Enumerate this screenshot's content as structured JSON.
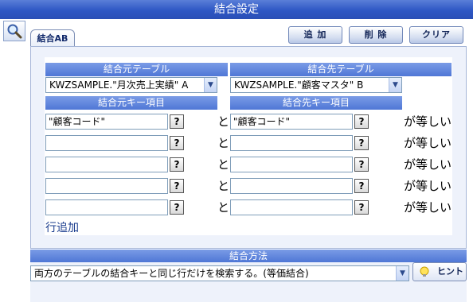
{
  "window": {
    "title": "結合設定"
  },
  "tab": {
    "label": "結合AB"
  },
  "toolbar": {
    "add_label": "追 加",
    "delete_label": "削 除",
    "clear_label": "クリア"
  },
  "source": {
    "table_header": "結合元テーブル",
    "table_value": "KWZSAMPLE.\"月次売上実績\" A",
    "key_header": "結合元キー項目"
  },
  "target": {
    "table_header": "結合先テーブル",
    "table_value": "KWZSAMPLE.\"顧客マスタ\" B",
    "key_header": "結合先キー項目"
  },
  "key_rows": [
    {
      "source_key": "\"顧客コード\"",
      "target_key": "\"顧客コード\""
    },
    {
      "source_key": "",
      "target_key": ""
    },
    {
      "source_key": "",
      "target_key": ""
    },
    {
      "source_key": "",
      "target_key": ""
    },
    {
      "source_key": "",
      "target_key": ""
    }
  ],
  "labels": {
    "help": "?",
    "and": "と",
    "equal": "が等しい",
    "add_row": "行追加"
  },
  "method": {
    "header": "結合方法",
    "selected": "両方のテーブルの結合キーと同じ行だけを検索する。(等価結合)",
    "hint_label": "ヒント"
  },
  "colors": {
    "title_bar": "#2e57c4",
    "header_blue": "#4f77d6",
    "panel_bg": "#eef2fb"
  },
  "icons": {
    "search": "magnifier-icon",
    "hint": "bulb-icon",
    "dropdown": "chevron-down-icon"
  }
}
